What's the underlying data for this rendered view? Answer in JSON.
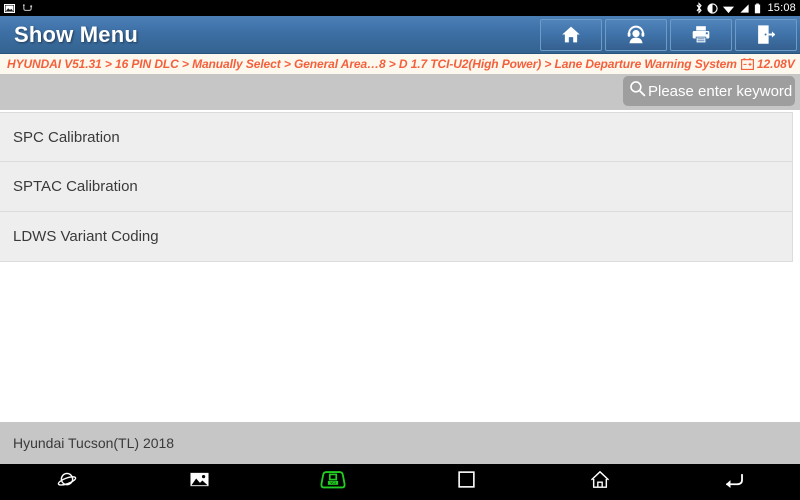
{
  "status_bar": {
    "left_icons": [
      "screenshot-icon",
      "usb-icon"
    ],
    "right_icons": [
      "bluetooth-icon",
      "dnd-icon",
      "wifi-icon",
      "signal-icon",
      "battery-icon"
    ],
    "clock": "15:08"
  },
  "title_bar": {
    "title": "Show Menu",
    "buttons": [
      {
        "name": "home-button",
        "icon": "home-icon"
      },
      {
        "name": "support-button",
        "icon": "headset-person-icon"
      },
      {
        "name": "print-button",
        "icon": "printer-icon"
      },
      {
        "name": "exit-button",
        "icon": "exit-door-icon"
      }
    ]
  },
  "breadcrumb": {
    "path": "HYUNDAI V51.31 > 16 PIN DLC > Manually Select > General Area…8 > D 1.7 TCI-U2(High Power) > Lane Departure Warning System",
    "battery_icon": "car-battery-icon",
    "voltage": "12.08V",
    "color": "#f4603c"
  },
  "search": {
    "icon": "search-icon",
    "placeholder": "Please enter keyword",
    "value": ""
  },
  "menu": {
    "items": [
      {
        "label": "SPC Calibration"
      },
      {
        "label": "SPTAC Calibration"
      },
      {
        "label": "LDWS Variant Coding"
      }
    ]
  },
  "footer": {
    "vehicle": "Hyundai Tucson(TL) 2018"
  },
  "nav_bar": {
    "buttons": [
      {
        "name": "browser-button",
        "icon": "planet-icon"
      },
      {
        "name": "gallery-button",
        "icon": "image-icon"
      },
      {
        "name": "vci-button",
        "icon": "vci-connector-icon",
        "color": "#22cc22"
      },
      {
        "name": "recents-button",
        "icon": "square-icon"
      },
      {
        "name": "home-nav-button",
        "icon": "home-outline-icon"
      },
      {
        "name": "back-button",
        "icon": "back-arrow-icon"
      }
    ]
  }
}
